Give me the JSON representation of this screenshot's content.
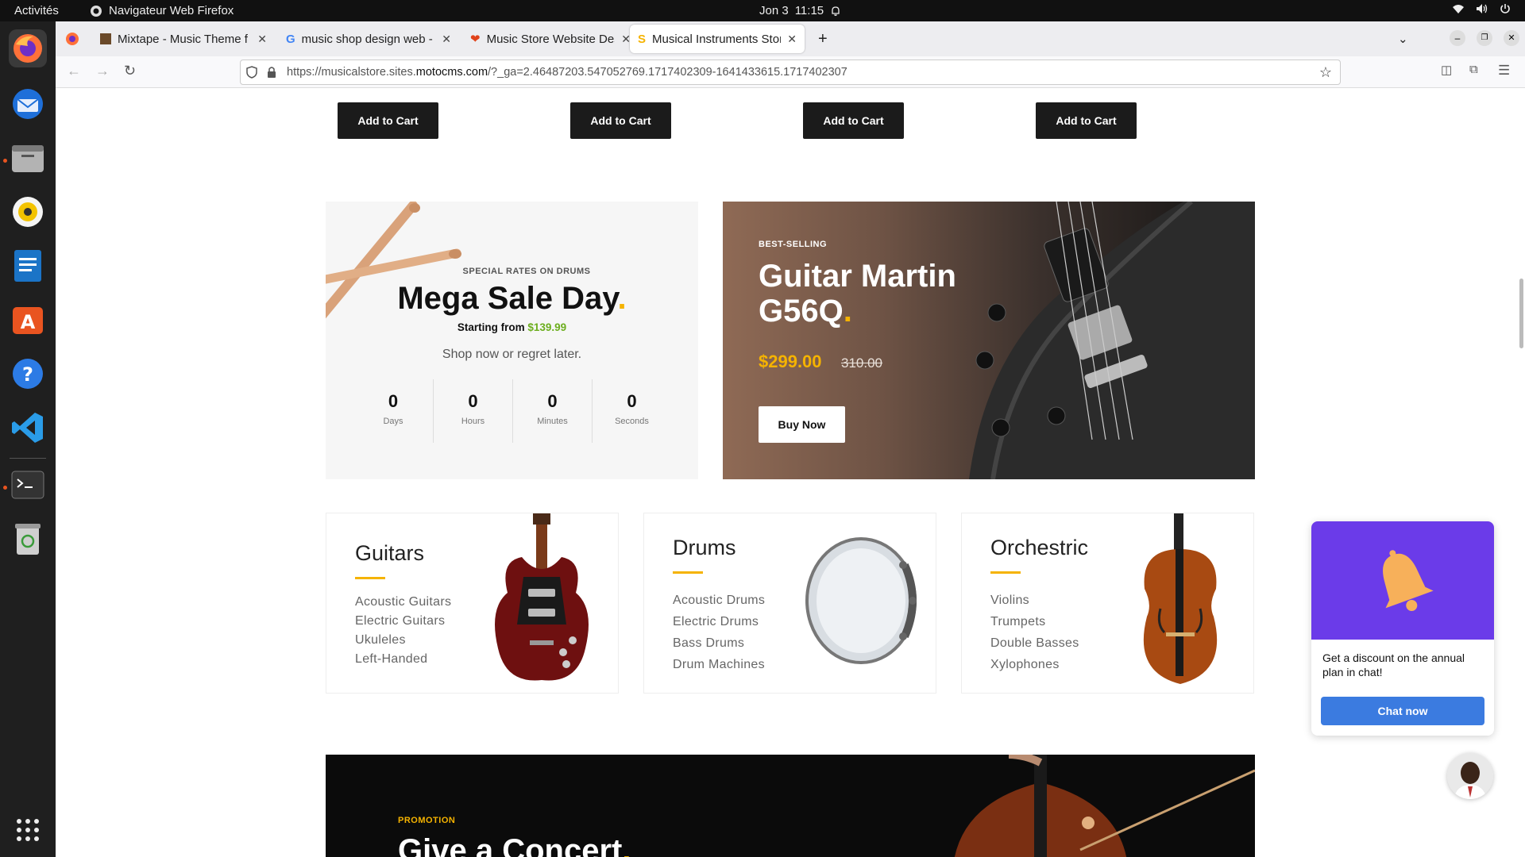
{
  "system": {
    "activities": "Activités",
    "app_name": "Navigateur Web Firefox",
    "date": "Jon 3",
    "time": "11:15"
  },
  "browser": {
    "tabs": [
      {
        "label": "Mixtape - Music Theme f"
      },
      {
        "label": "music shop design web -"
      },
      {
        "label": "Music Store Website Des"
      },
      {
        "label": "Musical Instruments Stor"
      }
    ],
    "url_prefix": "https://musicalstore.sites.",
    "url_domain": "motocms.com",
    "url_suffix": "/?_ga=2.46487203.547052769.1717402309-1641433615.1717402307"
  },
  "products": {
    "add_to_cart": [
      "Add to Cart",
      "Add to Cart",
      "Add to Cart",
      "Add to Cart"
    ]
  },
  "sale": {
    "kicker": "SPECIAL RATES ON DRUMS",
    "title": "Mega Sale Day",
    "dot": ".",
    "starting_from": "Starting from",
    "starting_price": "$139.99",
    "tagline": "Shop now or regret later.",
    "countdown": [
      {
        "value": "0",
        "label": "Days"
      },
      {
        "value": "0",
        "label": "Hours"
      },
      {
        "value": "0",
        "label": "Minutes"
      },
      {
        "value": "0",
        "label": "Seconds"
      }
    ]
  },
  "featured": {
    "kicker": "BEST-SELLING",
    "title_line1": "Guitar Martin",
    "title_line2": "G56Q",
    "dot": ".",
    "price": "$299.00",
    "old_price": "310.00",
    "button": "Buy Now"
  },
  "categories": [
    {
      "title": "Guitars",
      "items": [
        "Acoustic Guitars",
        "Electric Guitars",
        "Ukuleles",
        "Left-Handed"
      ]
    },
    {
      "title": "Drums",
      "items": [
        "Acoustic Drums",
        "Electric Drums",
        "Bass Drums",
        "Drum Machines"
      ]
    },
    {
      "title": "Orchestric",
      "items": [
        "Violins",
        "Trumpets",
        "Double Basses",
        "Xylophones"
      ]
    }
  ],
  "promo": {
    "kicker": "PROMOTION",
    "title": "Give a Concert",
    "dot": "."
  },
  "chat": {
    "message": "Get a discount on the annual plan in chat!",
    "button": "Chat now"
  },
  "colors": {
    "accent": "#f5b300",
    "price_green": "#6cae1e",
    "chat_purple": "#6b3be9",
    "chat_button": "#3b7be0",
    "dark_button": "#1b1b1b"
  }
}
